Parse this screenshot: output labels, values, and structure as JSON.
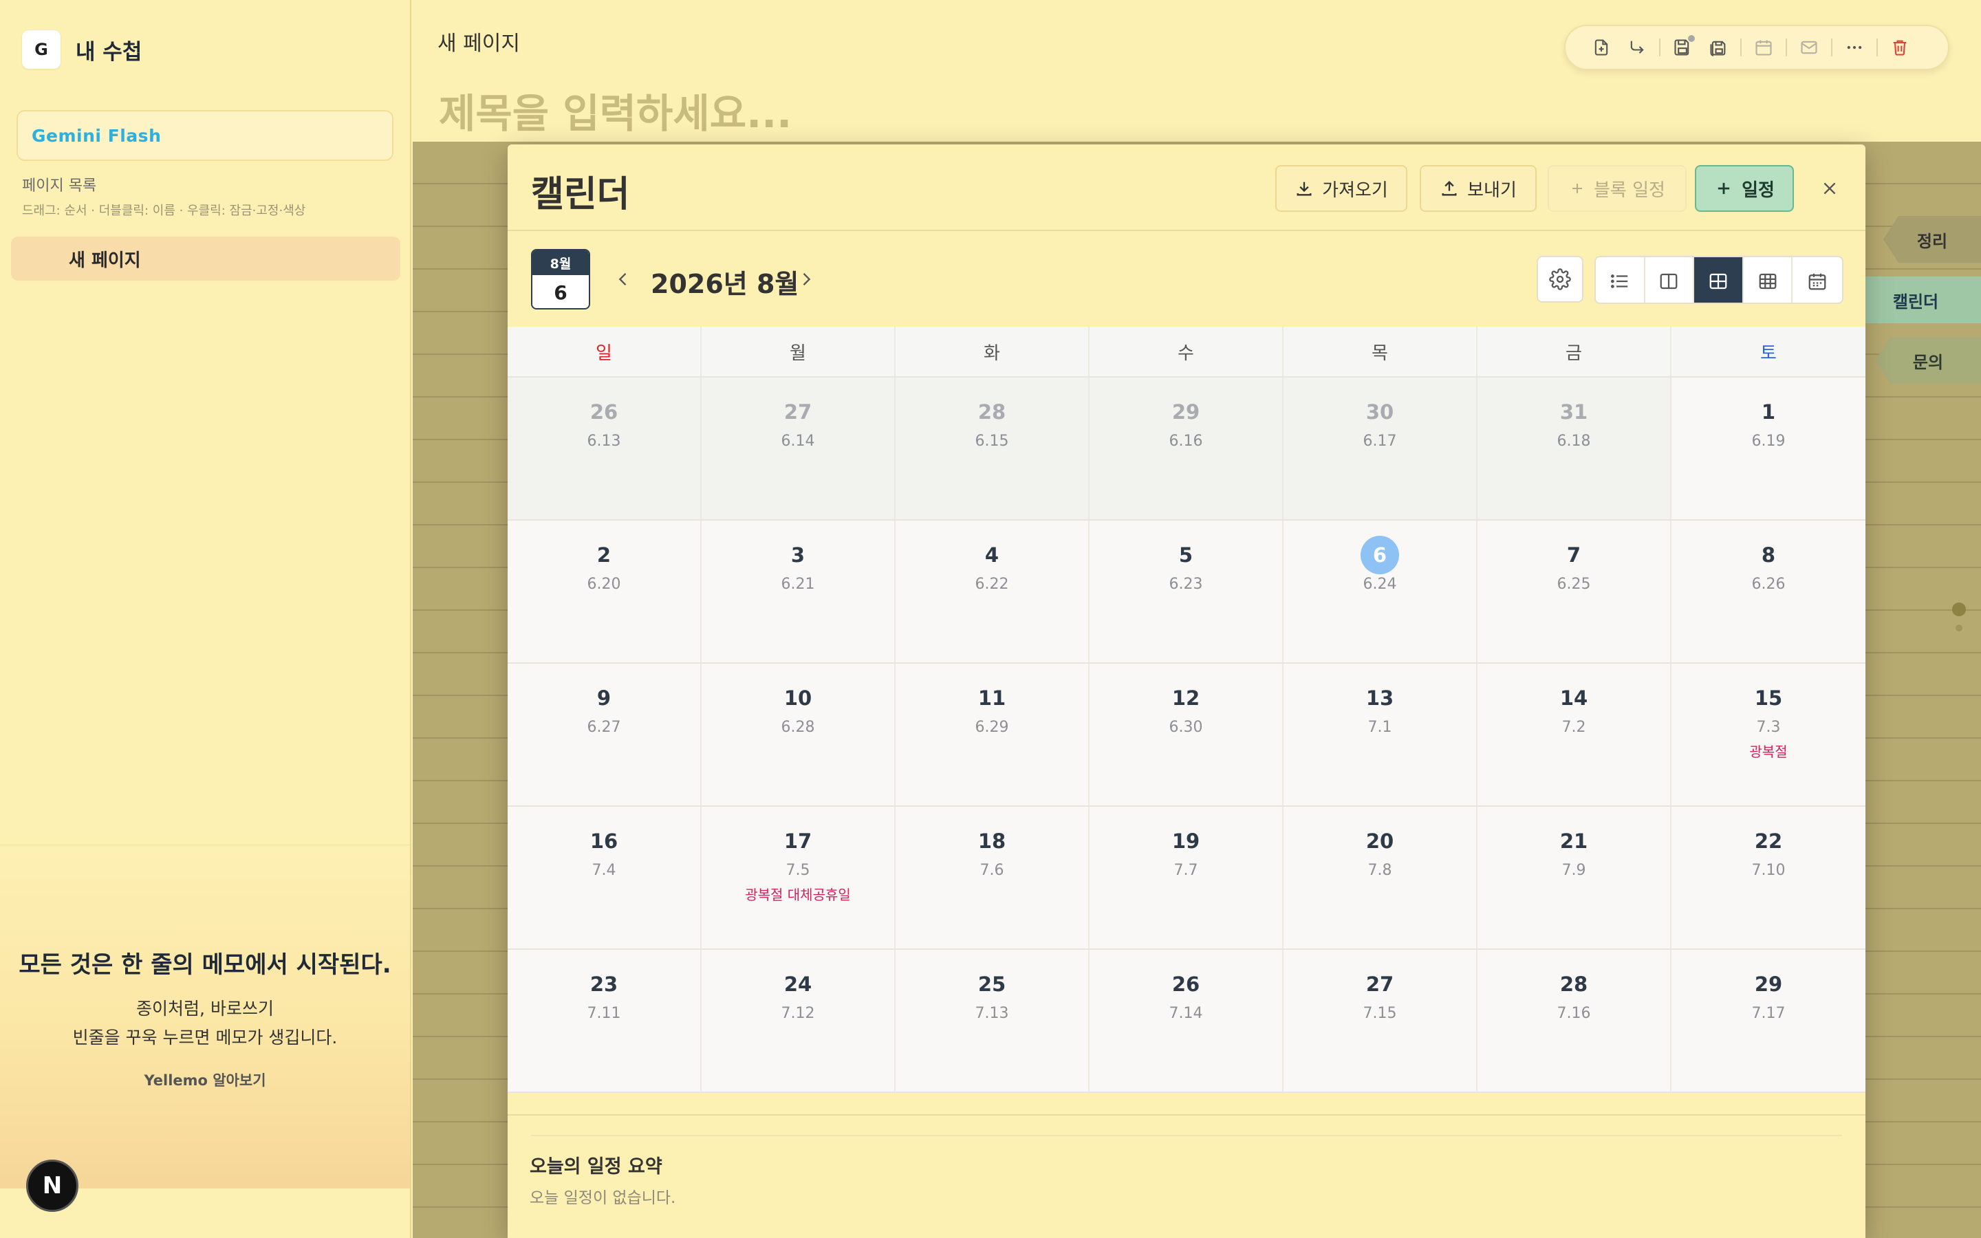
{
  "sidebar": {
    "brand_initial": "G",
    "brand_title": "내 수첩",
    "model": "Gemini Flash",
    "pages_label": "페이지 목록",
    "pages_hint": "드래그: 순서 · 더블클릭: 이름 · 우클릭: 잠금·고정·색상",
    "pages": [
      {
        "title": "새 페이지"
      }
    ],
    "promo": {
      "title": "모든 것은 한 줄의 메모에서 시작된다.",
      "line1": "종이처럼, 바로쓰기",
      "line2": "빈줄을 꾸욱 누르면 메모가 생깁니다.",
      "link": "Yellemo 알아보기"
    },
    "badge_letter": "N"
  },
  "editor": {
    "page_label": "새 페이지",
    "title_placeholder": "제목을 입력하세요...",
    "toolbar_icons": [
      "new-page-icon",
      "forward-icon",
      "save-icon",
      "save-all-icon",
      "calendar-icon",
      "mail-icon",
      "more-icon",
      "trash-icon"
    ]
  },
  "side_tabs": [
    {
      "label": "정리"
    },
    {
      "label": "캘린더"
    },
    {
      "label": "문의"
    }
  ],
  "calendar": {
    "title": "캘린더",
    "buttons": {
      "import": "가져오기",
      "export": "보내기",
      "block_schedule": "블록 일정",
      "add_schedule": "일정"
    },
    "mini": {
      "month": "8월",
      "day": "6"
    },
    "month_title": "2026년 8월",
    "weekdays": [
      "일",
      "월",
      "화",
      "수",
      "목",
      "금",
      "토"
    ],
    "weeks": [
      [
        {
          "day": "26",
          "lunar": "6.13",
          "other": true
        },
        {
          "day": "27",
          "lunar": "6.14",
          "other": true
        },
        {
          "day": "28",
          "lunar": "6.15",
          "other": true
        },
        {
          "day": "29",
          "lunar": "6.16",
          "other": true
        },
        {
          "day": "30",
          "lunar": "6.17",
          "other": true
        },
        {
          "day": "31",
          "lunar": "6.18",
          "other": true
        },
        {
          "day": "1",
          "lunar": "6.19"
        }
      ],
      [
        {
          "day": "2",
          "lunar": "6.20"
        },
        {
          "day": "3",
          "lunar": "6.21"
        },
        {
          "day": "4",
          "lunar": "6.22"
        },
        {
          "day": "5",
          "lunar": "6.23"
        },
        {
          "day": "6",
          "lunar": "6.24",
          "today": true
        },
        {
          "day": "7",
          "lunar": "6.25"
        },
        {
          "day": "8",
          "lunar": "6.26"
        }
      ],
      [
        {
          "day": "9",
          "lunar": "6.27"
        },
        {
          "day": "10",
          "lunar": "6.28"
        },
        {
          "day": "11",
          "lunar": "6.29"
        },
        {
          "day": "12",
          "lunar": "6.30"
        },
        {
          "day": "13",
          "lunar": "7.1"
        },
        {
          "day": "14",
          "lunar": "7.2"
        },
        {
          "day": "15",
          "lunar": "7.3",
          "holiday": "광복절"
        }
      ],
      [
        {
          "day": "16",
          "lunar": "7.4"
        },
        {
          "day": "17",
          "lunar": "7.5",
          "holiday": "광복절 대체공휴일"
        },
        {
          "day": "18",
          "lunar": "7.6"
        },
        {
          "day": "19",
          "lunar": "7.7"
        },
        {
          "day": "20",
          "lunar": "7.8"
        },
        {
          "day": "21",
          "lunar": "7.9"
        },
        {
          "day": "22",
          "lunar": "7.10"
        }
      ],
      [
        {
          "day": "23",
          "lunar": "7.11"
        },
        {
          "day": "24",
          "lunar": "7.12"
        },
        {
          "day": "25",
          "lunar": "7.13"
        },
        {
          "day": "26",
          "lunar": "7.14"
        },
        {
          "day": "27",
          "lunar": "7.15"
        },
        {
          "day": "28",
          "lunar": "7.16"
        },
        {
          "day": "29",
          "lunar": "7.17"
        }
      ]
    ],
    "summary": {
      "title": "오늘의 일정 요약",
      "empty": "오늘 일정이 없습니다."
    },
    "colors": {
      "sunday": "#dc2626",
      "saturday": "#2563eb",
      "holiday": "#d6205a",
      "today": "#8ec2f5",
      "accent_dark": "#2c3e50",
      "add_button": "#b7dfc2"
    }
  }
}
